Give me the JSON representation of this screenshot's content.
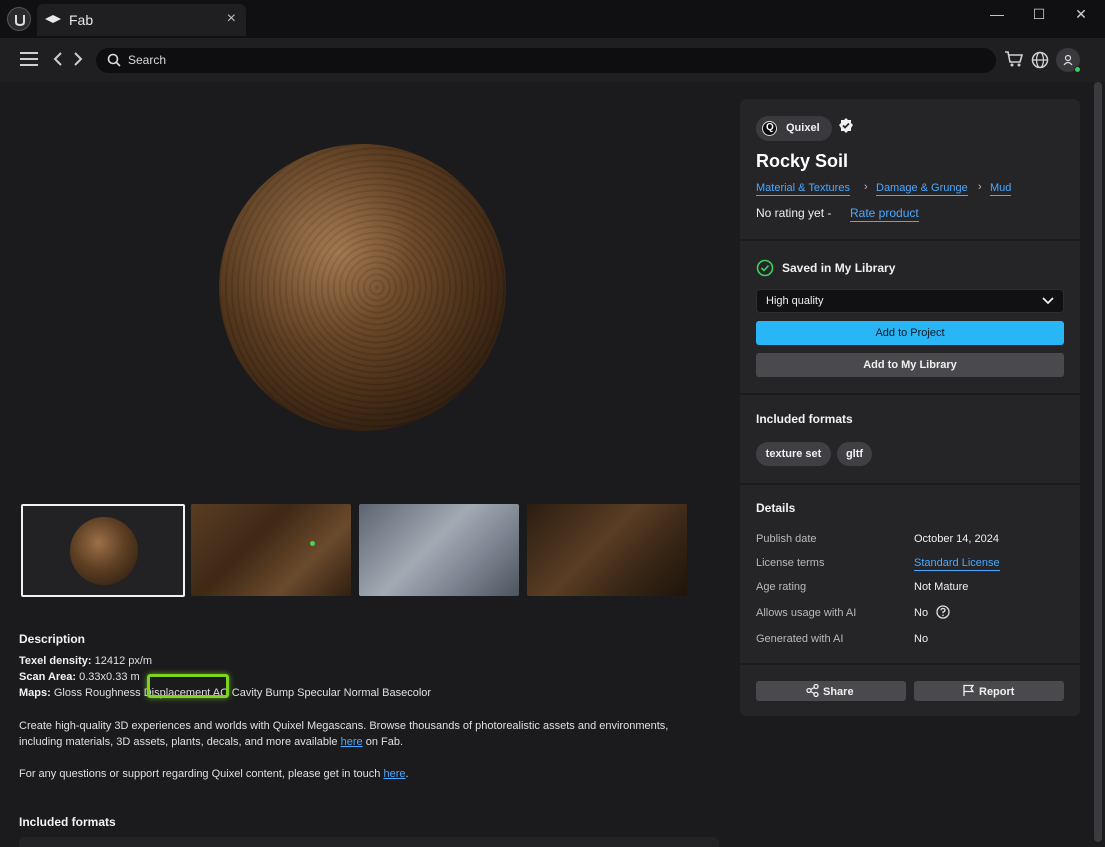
{
  "window": {
    "tab_title": "Fab",
    "tab_close": "×",
    "minimize": "—",
    "maximize": "☐",
    "close": "✕"
  },
  "nav": {
    "search_placeholder": "Search"
  },
  "product": {
    "publisher": "Quixel",
    "title": "Rocky Soil",
    "breadcrumbs": [
      "Material & Textures",
      "Damage & Grunge",
      "Mud"
    ],
    "rating_text": "No rating yet",
    "rating_sep": "-",
    "rate_link": "Rate product"
  },
  "library": {
    "saved_label": "Saved in My Library",
    "quality_selected": "High quality",
    "add_to_project": "Add to Project",
    "add_to_library": "Add to My Library"
  },
  "formats": {
    "heading": "Included formats",
    "items": [
      "texture set",
      "gltf"
    ]
  },
  "details": {
    "heading": "Details",
    "rows": [
      {
        "label": "Publish date",
        "value": "October 14, 2024"
      },
      {
        "label": "License terms",
        "value": "Standard License"
      },
      {
        "label": "Age rating",
        "value": "Not Mature"
      },
      {
        "label": "Allows usage with AI",
        "value": "No"
      },
      {
        "label": "Generated with AI",
        "value": "No"
      }
    ]
  },
  "actions": {
    "share": "Share",
    "report": "Report"
  },
  "description": {
    "heading": "Description",
    "texel_label": "Texel density:",
    "texel_value": "12412 px/m",
    "scan_label": "Scan Area:",
    "scan_value": "0.33x0.33 m",
    "maps_label": "Maps:",
    "maps_value": "Gloss Roughness Displacement AO Cavity Bump Specular Normal Basecolor",
    "para1_start": "Create high-quality 3D experiences and worlds with Quixel Megascans. Browse thousands of photorealistic assets and environments, including materials, 3D assets, plants, decals, and more available",
    "para1_link": "here",
    "para1_end": "on Fab.",
    "para2_start": "For any questions or support regarding Quixel content, please get in touch",
    "para2_link": "here",
    "para2_end": ".",
    "included_heading": "Included formats"
  },
  "colors": {
    "accent": "#29b6f6",
    "link": "#4aa8ff",
    "highlight": "#7ed321"
  }
}
